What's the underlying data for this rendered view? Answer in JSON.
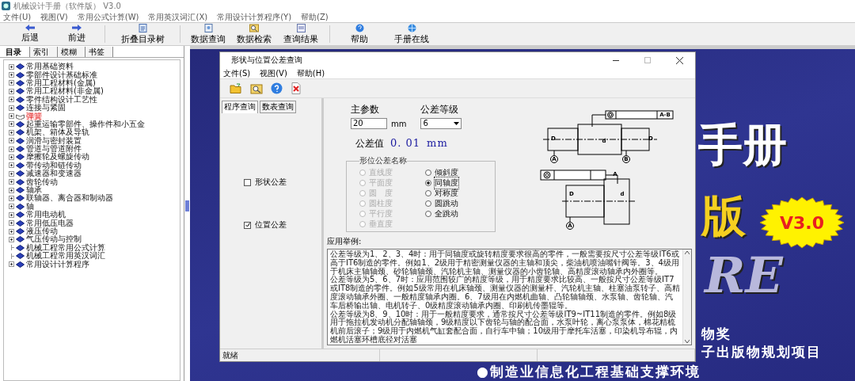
{
  "window": {
    "title": "机械设计手册（软件版） V3.0"
  },
  "menu": [
    "文件(U)",
    "视图(V)",
    "常用公式计算(W)",
    "常用英汉词汇(X)",
    "常用设计计算程序(Y)",
    "帮助(Z)"
  ],
  "toolbar": [
    {
      "label": "后退",
      "kind": "back"
    },
    {
      "label": "前进",
      "kind": "forward"
    },
    {
      "label": "折叠目录树",
      "kind": "tree"
    },
    {
      "label": "数据查询",
      "kind": "query"
    },
    {
      "label": "数据检索",
      "kind": "search"
    },
    {
      "label": "查询结果",
      "kind": "result"
    },
    {
      "label": "帮助",
      "kind": "help"
    },
    {
      "label": "手册在线",
      "kind": "online"
    }
  ],
  "nav_tabs": [
    {
      "label": "目录",
      "selected": true
    },
    {
      "label": "索引",
      "selected": false
    },
    {
      "label": "模糊",
      "selected": false
    },
    {
      "label": "书签",
      "selected": false
    }
  ],
  "tree": [
    {
      "label": "常用基础资料",
      "kind": "branch",
      "selected": false
    },
    {
      "label": "零部件设计基础标准",
      "kind": "branch",
      "selected": false
    },
    {
      "label": "常用工程材料(金属)",
      "kind": "branch",
      "selected": false
    },
    {
      "label": "常用工程材料(非金属)",
      "kind": "branch",
      "selected": false
    },
    {
      "label": "零件结构设计工艺性",
      "kind": "branch",
      "selected": false
    },
    {
      "label": "连接与紧固",
      "kind": "branch",
      "selected": false
    },
    {
      "label": "弹簧",
      "kind": "branch",
      "selected": true
    },
    {
      "label": "起重运输零部件、操作件和小五金",
      "kind": "branch",
      "selected": false
    },
    {
      "label": "机架、箱体及导轨",
      "kind": "branch",
      "selected": false
    },
    {
      "label": "润滑与密封装置",
      "kind": "branch",
      "selected": false
    },
    {
      "label": "管道与管道附件",
      "kind": "branch",
      "selected": false
    },
    {
      "label": "摩擦轮及螺旋传动",
      "kind": "branch",
      "selected": false
    },
    {
      "label": "带传动和链传动",
      "kind": "branch",
      "selected": false
    },
    {
      "label": "减速器和变速器",
      "kind": "branch",
      "selected": false
    },
    {
      "label": "齿轮传动",
      "kind": "branch",
      "selected": false
    },
    {
      "label": "轴承",
      "kind": "branch",
      "selected": false
    },
    {
      "label": "联轴器、离合器和制动器",
      "kind": "branch",
      "selected": false
    },
    {
      "label": "轴",
      "kind": "branch",
      "selected": false
    },
    {
      "label": "常用电动机",
      "kind": "branch",
      "selected": false
    },
    {
      "label": "常用低压电器",
      "kind": "branch",
      "selected": false
    },
    {
      "label": "液压传动",
      "kind": "branch",
      "selected": false
    },
    {
      "label": "气压传动与控制",
      "kind": "branch",
      "selected": false
    },
    {
      "label": "机械工程常用公式计算",
      "kind": "leaf",
      "selected": false
    },
    {
      "label": "机械工程常用英汉词汇",
      "kind": "leaf",
      "selected": false
    },
    {
      "label": "常用设计计算程序",
      "kind": "branch",
      "selected": false
    }
  ],
  "splash": {
    "title": "手册",
    "edition": "版",
    "version": "V3.0",
    "latin": "RE",
    "lines": [
      "物奖",
      "子出版物规划项目",
      "●制造业信息化工程基础支撑环境"
    ]
  },
  "dialog": {
    "title": "形状与位置公差查询",
    "menu": [
      "文件(S)",
      "视图(V)",
      "帮助(H)"
    ],
    "toolbar": [
      {
        "kind": "open"
      },
      {
        "kind": "search"
      },
      {
        "kind": "help"
      },
      {
        "kind": "close"
      }
    ],
    "tabs": [
      {
        "label": "程序查询",
        "selected": true
      },
      {
        "label": "数表查询",
        "selected": false
      }
    ],
    "checks": [
      {
        "label": "形状公差",
        "checked": false
      },
      {
        "label": "位置公差",
        "checked": true
      }
    ],
    "param_label": "主参数",
    "param_value": "20",
    "param_unit": "mm",
    "grade_label": "公差等级",
    "grade_value": "6",
    "result_label": "公差值",
    "result_value": "0. 01",
    "result_unit": "mm",
    "group_title": "形位公差名称",
    "radios_left": [
      {
        "label": "直线度",
        "disabled": true,
        "selected": false
      },
      {
        "label": "平面度",
        "disabled": true,
        "selected": false
      },
      {
        "label": "圆　度",
        "disabled": true,
        "selected": false
      },
      {
        "label": "圆柱度",
        "disabled": true,
        "selected": false
      },
      {
        "label": "平行度",
        "disabled": true,
        "selected": false
      },
      {
        "label": "垂直度",
        "disabled": true,
        "selected": false
      }
    ],
    "radios_right": [
      {
        "label": "倾斜度",
        "disabled": false,
        "selected": false
      },
      {
        "label": "同轴度",
        "disabled": false,
        "selected": true
      },
      {
        "label": "对称度",
        "disabled": false,
        "selected": false
      },
      {
        "label": "圆跳动",
        "disabled": false,
        "selected": false
      },
      {
        "label": "全跳动",
        "disabled": false,
        "selected": false
      }
    ],
    "drawing_labels": [
      "A-B",
      "D",
      "d",
      "D",
      "A",
      "B",
      "A",
      "D",
      "d",
      "A"
    ],
    "example_label": "应用举例:",
    "example_paragraphs": [
      "公差等级为1、2、3、4时：用于同轴度或旋转精度要求很高的零件，一般需要按尺寸公差等级IT6或高于IT6制造的零件。例如1、2级用于精密测量仪器的主轴和顶尖，柴油机喷油嘴针阀等。3、4级用于机床主轴轴颈、砂轮轴轴颈、汽轮机主轴、测量仪器的小齿轮轴、高精度滚动轴承内外圈等。",
      "公差等级为5、6、7时：应用范围较广的精度等级，用于精度要求比较高、一般按尺寸公差等级IT7或IT8制造的零件。例如5级常用在机床轴颈、测量仪器的测量杆、汽轮机主轴、柱塞油泵转子、高精度滚动轴承外圈、一般精度轴承内圈。6、7级用在内燃机曲轴、凸轮轴轴颈、水泵轴、齿轮轴、汽车后桥输出轴、电机转子、0级精度滚动轴承内圈、印刷机传墨辊等。",
      "公差等级为8、9、10时：用于一般精度要求，通常按尺寸公差等级IT9~IT11制造的零件。例如8级用于拖拉机发动机分配轴轴颈，9级精度以下齿轮与轴的配合面，水泵叶轮，离心泵泵体，棉花精梳机前后滚子；9级用于内燃机气缸套配合面，自行车中轴；10级用于摩托车活塞，印染机导布辊，内燃机活塞环槽底径对活塞"
    ],
    "status": "就绪"
  }
}
